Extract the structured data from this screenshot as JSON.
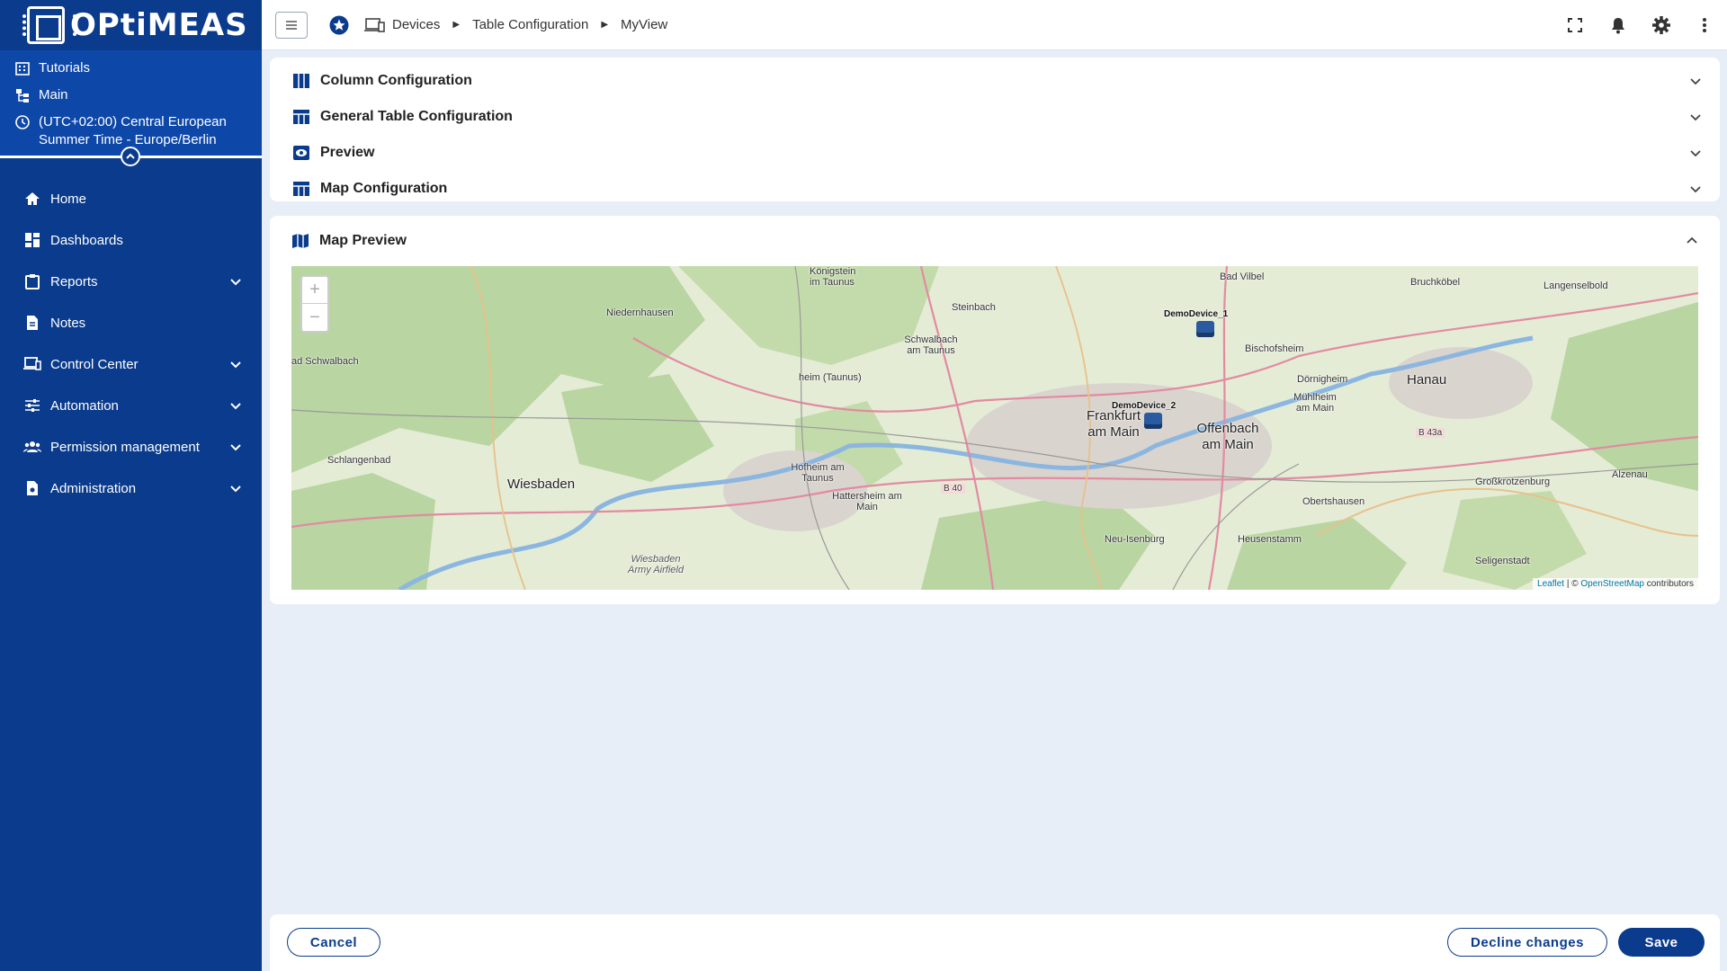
{
  "brand": {
    "name": "OPtiMEAS"
  },
  "context": {
    "tutorials": "Tutorials",
    "main": "Main",
    "timezone_line1": "(UTC+02:00) Central European",
    "timezone_line2": "Summer Time - Europe/Berlin"
  },
  "nav": [
    {
      "label": "Home",
      "icon": "home-icon",
      "expandable": false
    },
    {
      "label": "Dashboards",
      "icon": "dashboard-icon",
      "expandable": false
    },
    {
      "label": "Reports",
      "icon": "clipboard-icon",
      "expandable": true
    },
    {
      "label": "Notes",
      "icon": "document-icon",
      "expandable": false
    },
    {
      "label": "Control Center",
      "icon": "devices-icon",
      "expandable": true
    },
    {
      "label": "Automation",
      "icon": "sliders-icon",
      "expandable": true
    },
    {
      "label": "Permission management",
      "icon": "users-icon",
      "expandable": true
    },
    {
      "label": "Administration",
      "icon": "admin-document-icon",
      "expandable": true
    }
  ],
  "breadcrumb": [
    "Devices",
    "Table Configuration",
    "MyView"
  ],
  "sections": {
    "column_config": "Column Configuration",
    "general_table": "General Table Configuration",
    "preview": "Preview",
    "map_config": "Map Configuration",
    "map_preview": "Map Preview"
  },
  "map": {
    "zoom_in": "+",
    "zoom_out": "−",
    "devices": [
      "DemoDevice_1",
      "DemoDevice_2"
    ],
    "places": {
      "koenigstein": "Königstein im Taunus",
      "badvilbel": "Bad Vilbel",
      "bruchkoebel": "Bruchköbel",
      "langenselbold": "Langenselbold",
      "niedernhausen": "Niedernhausen",
      "steinbach": "Steinbach",
      "schwalbach": "Schwalbach am Taunus",
      "badschwalbach": "ad Schwalbach",
      "bischofsheim": "Bischofsheim",
      "doernigheim": "Dörnigheim",
      "hanau": "Hanau",
      "muehlheim": "Mühlheim am Main",
      "heimtaunus": "heim (Taunus)",
      "frankfurt": "Frankfurt am Main",
      "offenbach": "Offenbach am Main",
      "schlangenbad": "Schlangenbad",
      "wiesbaden": "Wiesbaden",
      "hofheim": "Hofheim am Taunus",
      "hattersheim": "Hattersheim am Main",
      "grosskrotzenburg": "Großkrotzenburg",
      "alzenau": "Alzenau",
      "obertshausen": "Obertshausen",
      "neuisenburg": "Neu-Isenburg",
      "heusenstamm": "Heusenstamm",
      "seligenstadt": "Seligenstadt",
      "airfield": "Wiesbaden Army Airfield",
      "b40": "B 40",
      "b43a": "B 43a"
    },
    "attribution": {
      "leaflet": "Leaflet",
      "sep": " | © ",
      "osm": "OpenStreetMap",
      "suffix": " contributors"
    }
  },
  "buttons": {
    "cancel": "Cancel",
    "decline": "Decline changes",
    "save": "Save"
  }
}
